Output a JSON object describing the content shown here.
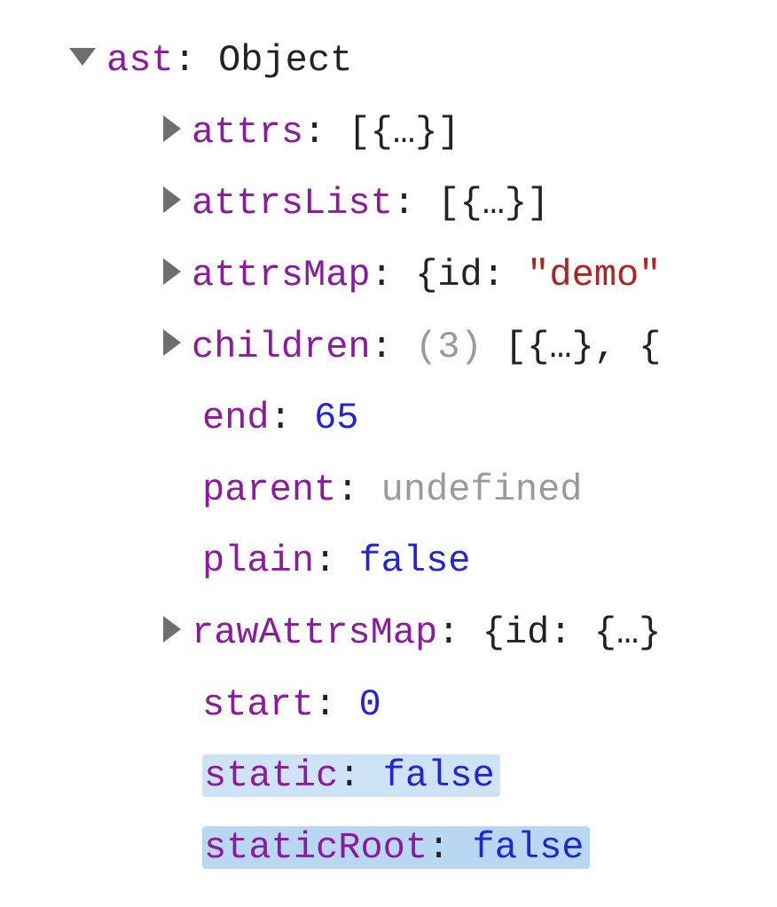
{
  "root": {
    "key": "ast",
    "type": "Object"
  },
  "props": {
    "attrs": {
      "key": "attrs",
      "preview": "[{…}]"
    },
    "attrsList": {
      "key": "attrsList",
      "preview": "[{…}]"
    },
    "attrsMap": {
      "key": "attrsMap",
      "id_key": "id",
      "id_val": "\"demo\"",
      "open": "{"
    },
    "children": {
      "key": "children",
      "count": "(3)",
      "preview": "[{…}, {"
    },
    "end": {
      "key": "end",
      "value": "65"
    },
    "parent": {
      "key": "parent",
      "value": "undefined"
    },
    "plain": {
      "key": "plain",
      "value": "false"
    },
    "rawAttrsMap": {
      "key": "rawAttrsMap",
      "id_key": "id",
      "nested": "{…}",
      "open": "{"
    },
    "start": {
      "key": "start",
      "value": "0"
    },
    "static": {
      "key": "static",
      "value": "false"
    },
    "staticRoot": {
      "key": "staticRoot",
      "value": "false"
    }
  },
  "colon": ":"
}
